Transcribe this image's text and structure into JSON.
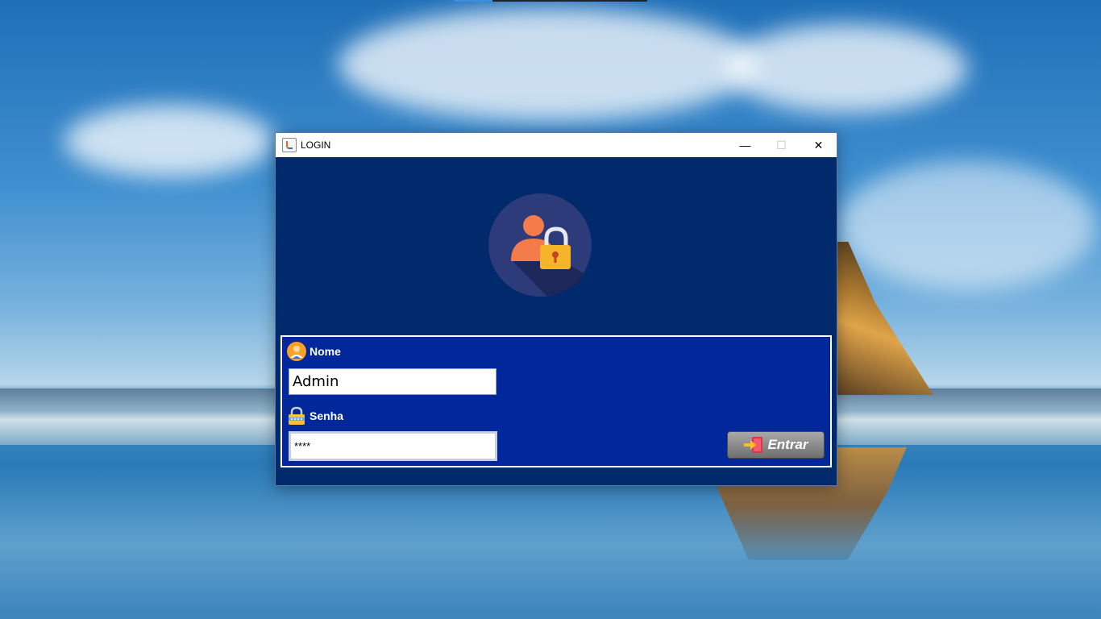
{
  "window": {
    "title": "LOGIN",
    "controls": {
      "minimize": "—",
      "maximize": "☐",
      "close": "✕"
    }
  },
  "icons": {
    "app": "java-icon",
    "logo": "user-lock-icon",
    "nome": "user-icon",
    "senha": "padlock-icon",
    "entrar": "login-arrow-icon"
  },
  "form": {
    "nome_label": "Nome",
    "nome_value": "Admin",
    "senha_label": "Senha",
    "senha_value": "****",
    "submit_label": "Entrar"
  },
  "colors": {
    "window_bg": "#002a6c",
    "panel_bg": "#00289a",
    "logo_circle": "#2d3b7a",
    "person": "#f47c4a",
    "lock": "#f5b52a"
  }
}
